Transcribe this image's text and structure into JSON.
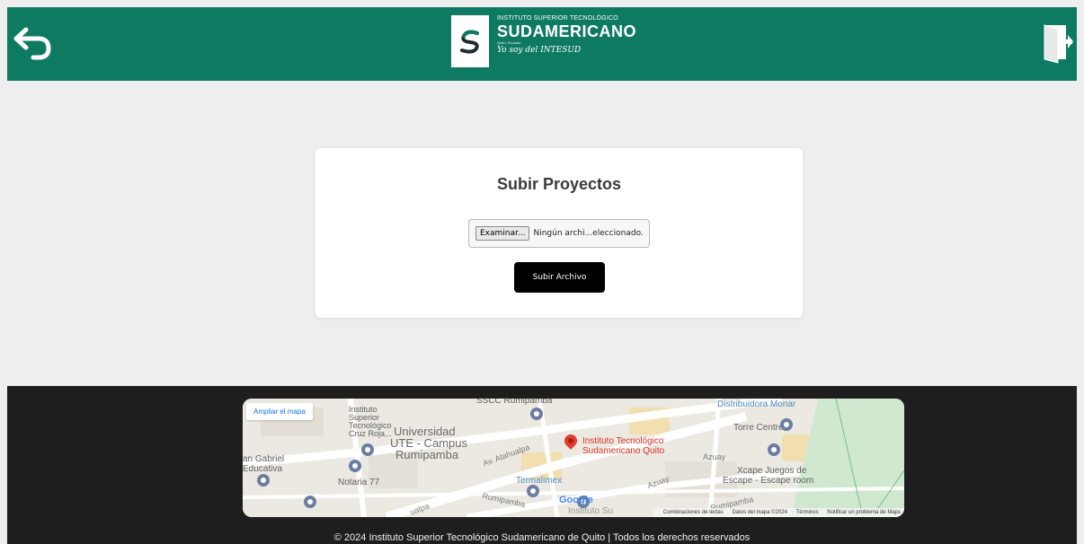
{
  "header": {
    "back_icon": "back-arrow-icon",
    "logo_icon": "intesud-s-logo-icon",
    "brand_top": "INSTITUTO SUPERIOR TECNOLÓGICO",
    "brand_main": "SUDAMERICANO",
    "brand_small": "Quito, Ecuador",
    "brand_slogan": "Yo soy del INTESUD",
    "exit_icon": "logout-door-icon",
    "color": "#0f7a62"
  },
  "upload": {
    "title": "Subir Proyectos",
    "browse_label": "Examinar...",
    "file_status": "Ningún archi...eleccionado.",
    "submit_label": "Subir Archivo"
  },
  "map": {
    "expand_label": "Ampliar el mapa",
    "labels": {
      "sscc": "SSCC Rumipamba",
      "distribuidora": "Distribuidora Monar",
      "instituto_cruz": "Instituto Superior Tecnológico Cruz Roja...",
      "universidad_1": "Universidad",
      "universidad_2": "UTE - Campus",
      "universidad_3": "Rumipamba",
      "main_place_1": "Instituto Tecnológico",
      "main_place_2": "Sudamericano Quito",
      "torre": "Torre Centre",
      "azuay1": "Azuay",
      "azuay2": "Azuay",
      "gabriel_1": "an Gabriel",
      "gabriel_2": "Educativa",
      "notaria": "Notaria 77",
      "atahualpa": "Av. Atahualpa",
      "termalimex": "Termalimex",
      "xcape_1": "Xcape Juegos de",
      "xcape_2": "Escape - Escape room",
      "rumipamba1": "Rumipamba",
      "rumipamba2": "Rumipamba",
      "hualpa": "ualpa",
      "instituto_short": "Instituto Su"
    },
    "google": "Google",
    "attribution": {
      "shortcuts": "Combinaciones de teclas",
      "map_data": "Datos del mapa ©2024",
      "terms": "Términos",
      "report": "Notificar un problema de Maps"
    }
  },
  "footer": {
    "copyright": "© 2024 Instituto Superior Tecnológico Sudamericano de Quito | Todos los derechos reservados"
  }
}
